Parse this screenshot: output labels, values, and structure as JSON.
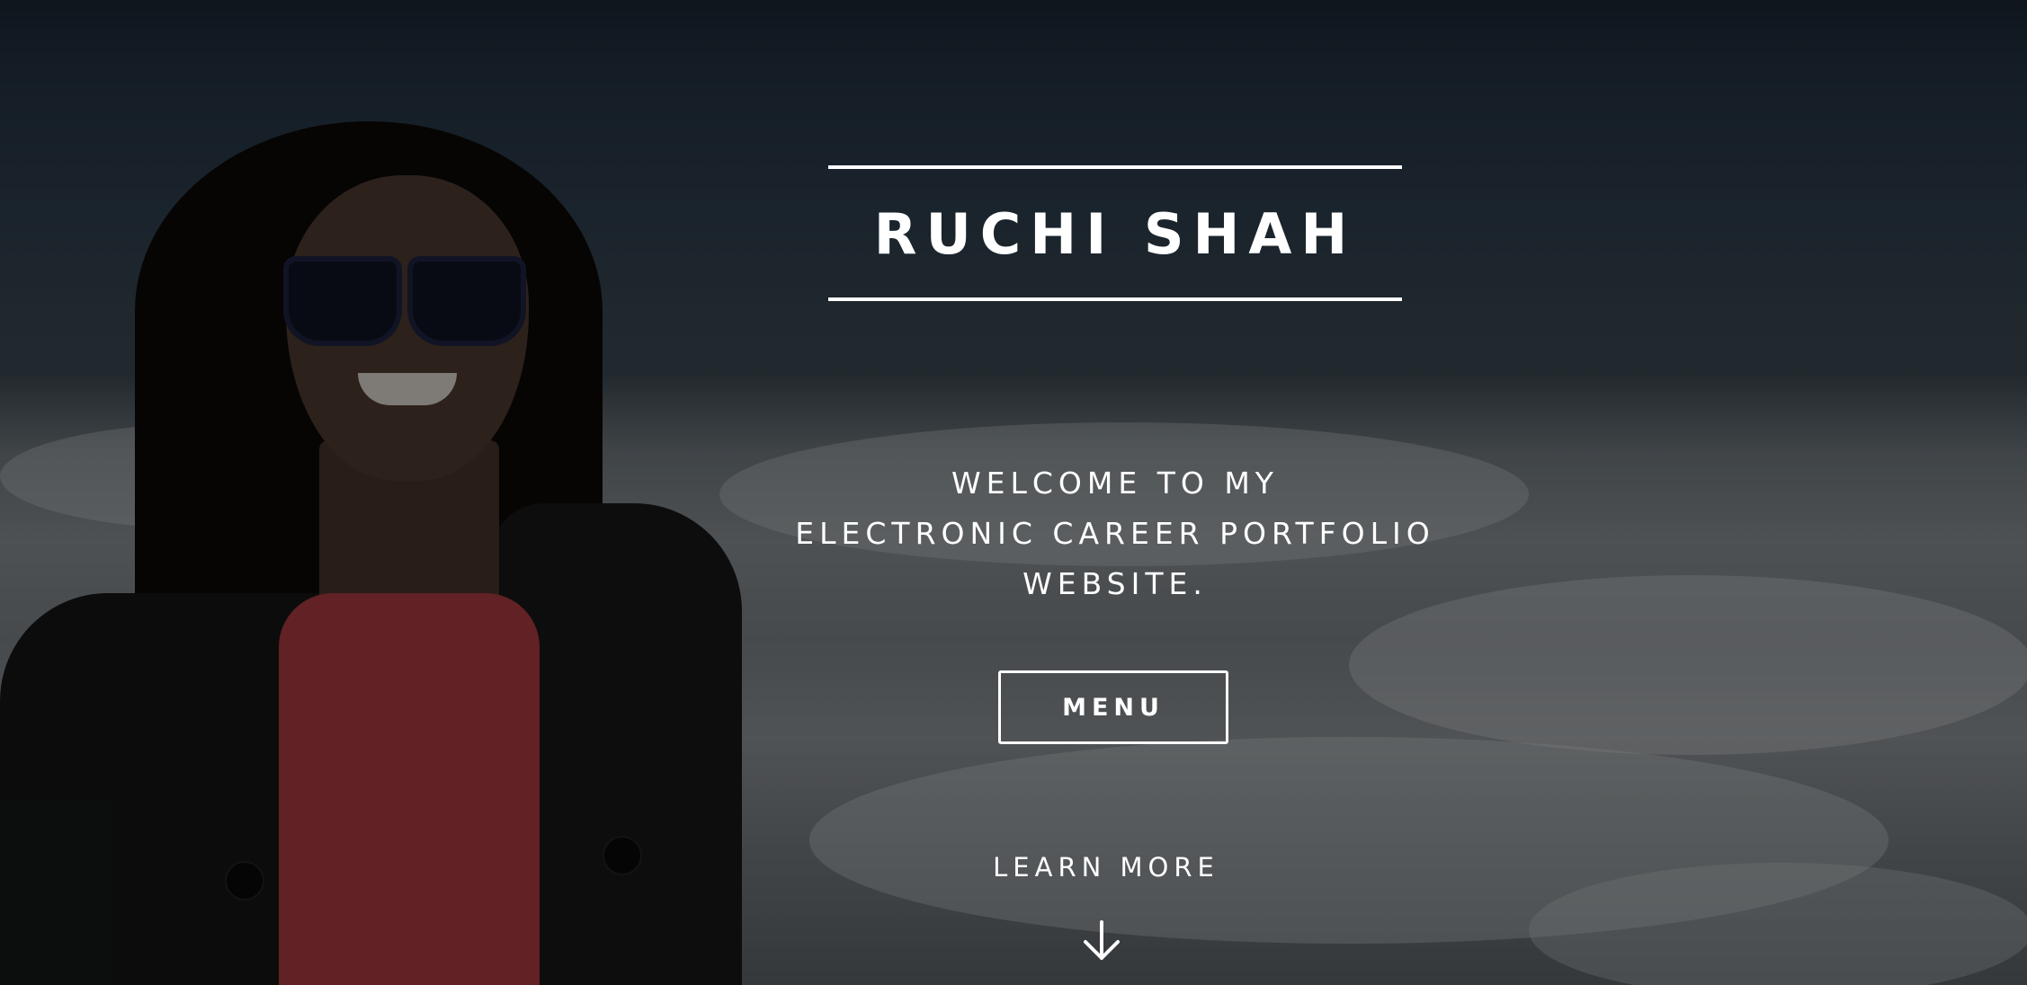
{
  "hero": {
    "title": "RUCHI SHAH",
    "welcome_lines": [
      "WELCOME TO MY",
      "ELECTRONIC CAREER PORTFOLIO",
      "WEBSITE."
    ],
    "menu_label": "MENU",
    "learn_more_label": "LEARN MORE",
    "arrow_icon": "arrow-down-icon"
  },
  "colors": {
    "text": "#ffffff",
    "overlay": "rgba(0,0,0,0.42)"
  }
}
